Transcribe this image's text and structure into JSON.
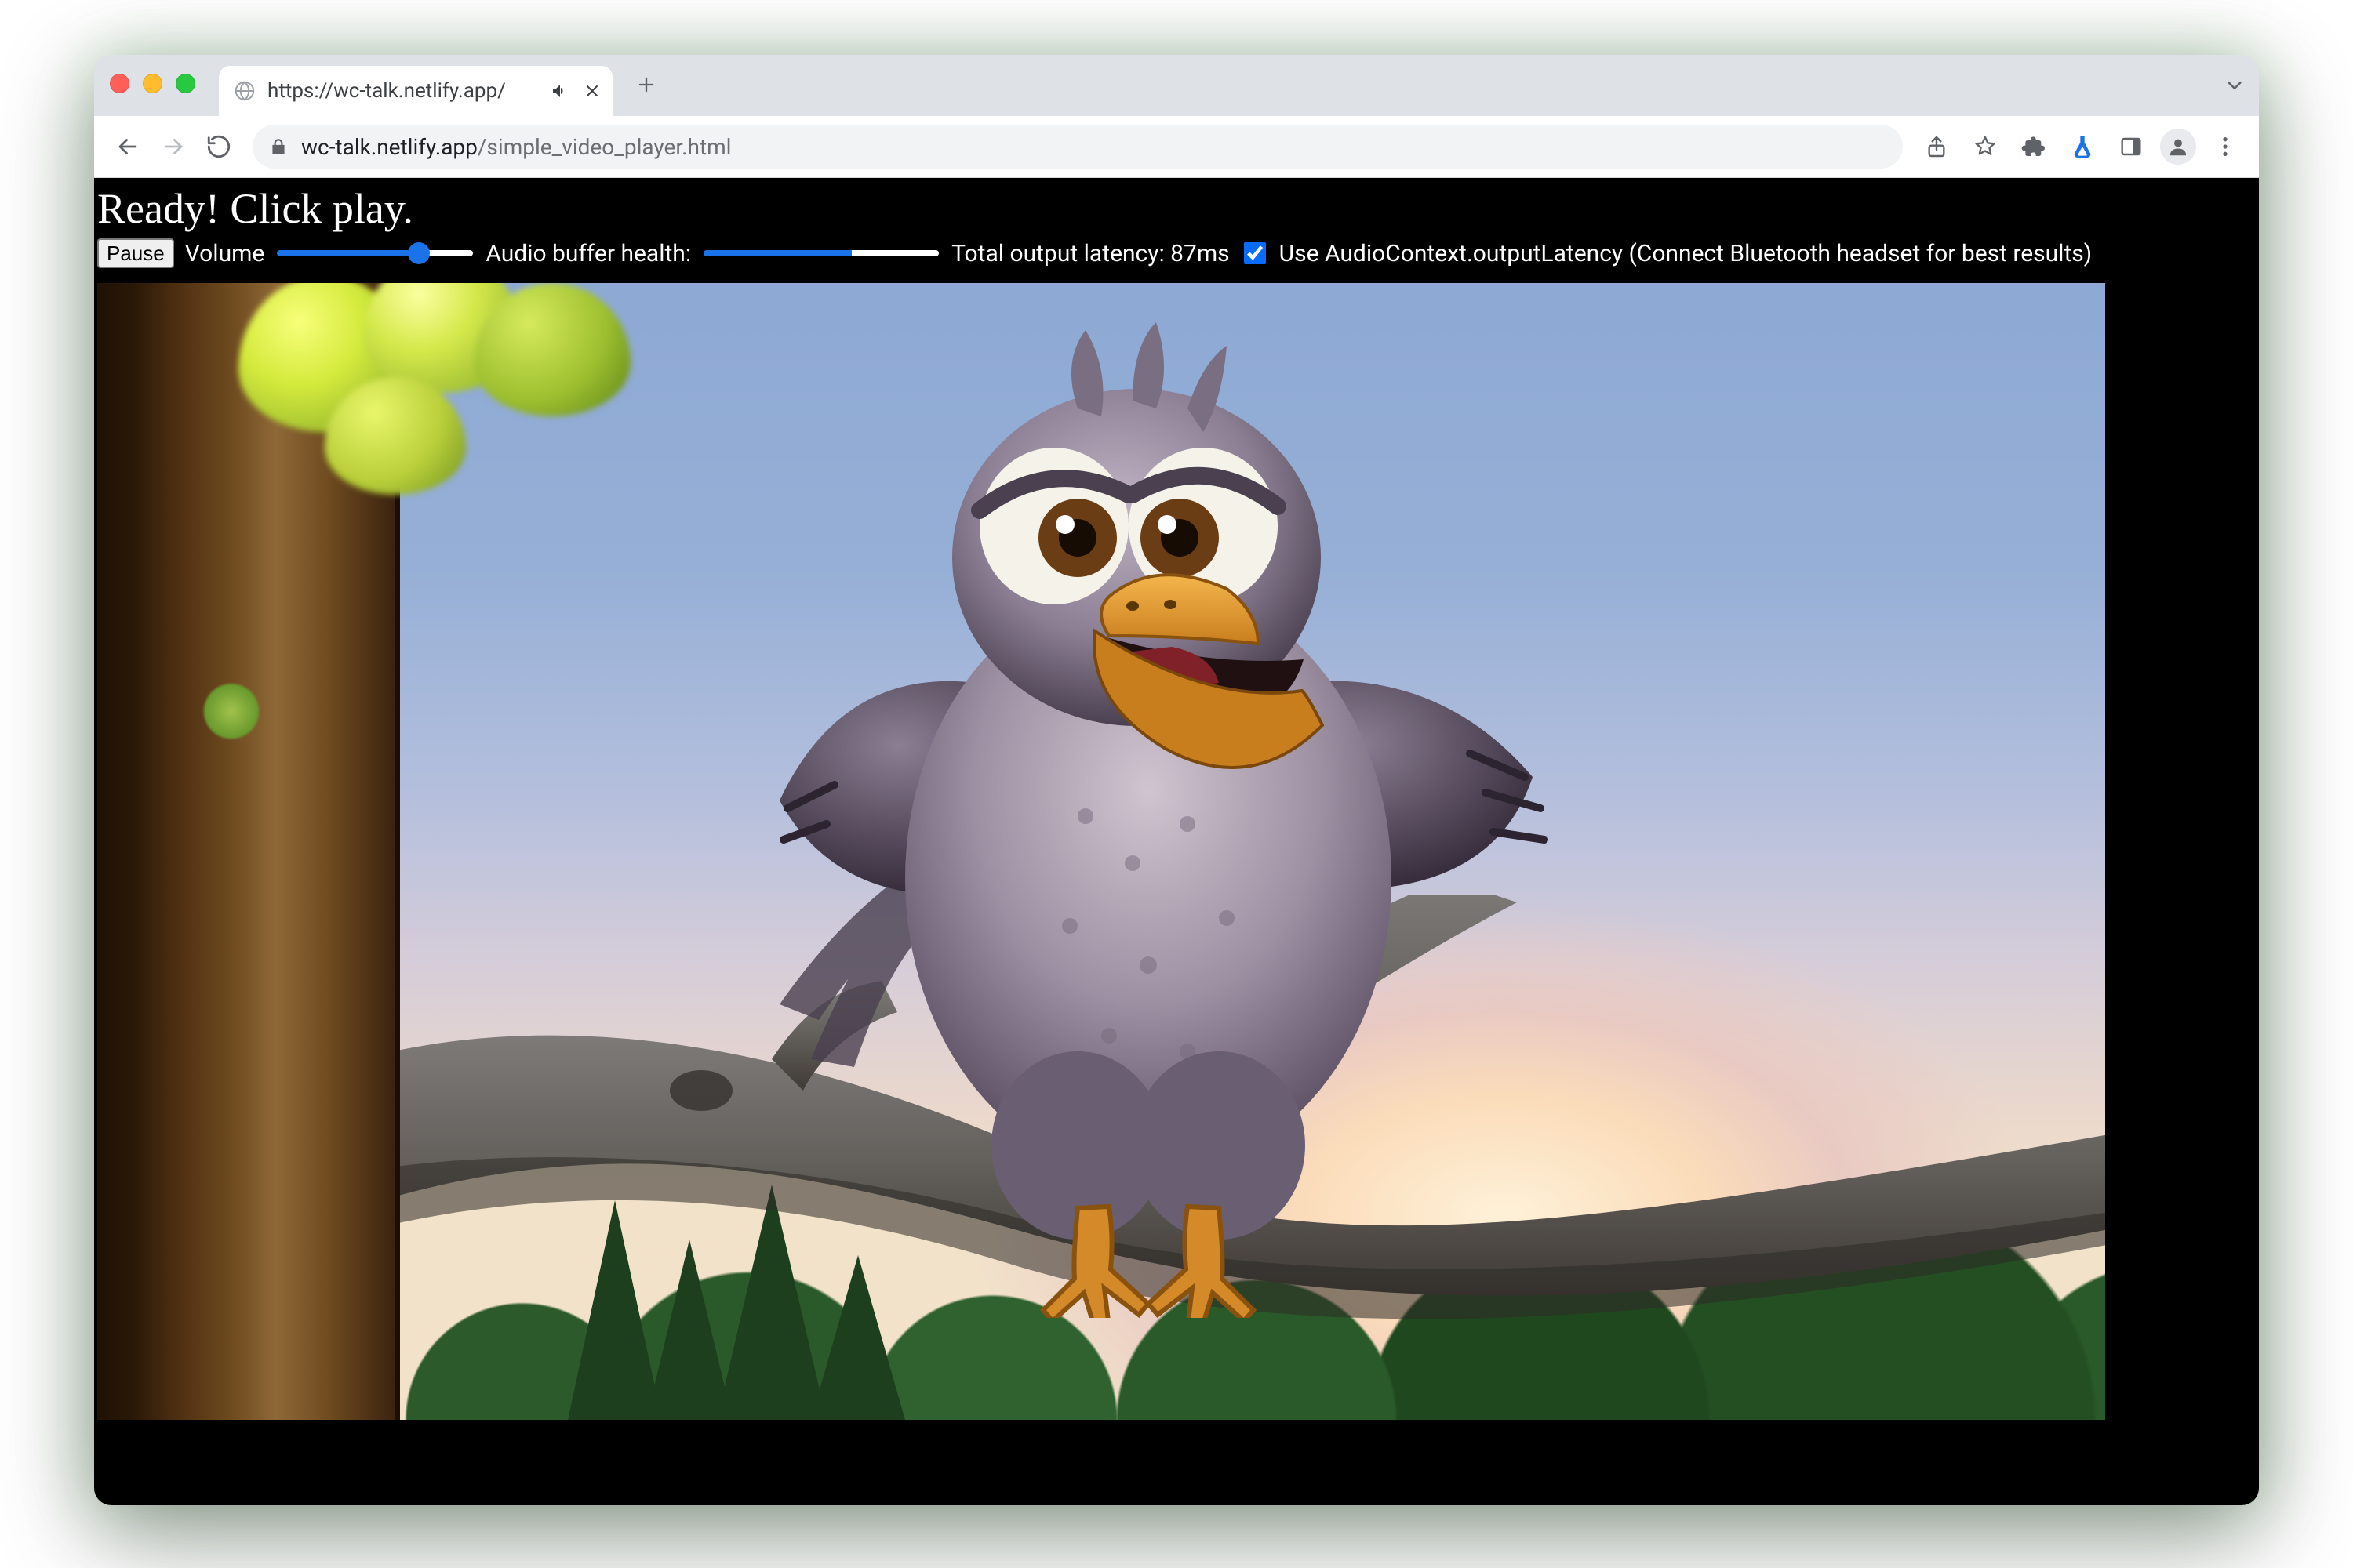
{
  "tab": {
    "title": "https://wc-talk.netlify.app/",
    "audio_playing": true
  },
  "address_bar": {
    "host": "wc-talk.netlify.app",
    "path": "/simple_video_player.html"
  },
  "page": {
    "status_heading": "Ready! Click play.",
    "pause_button": "Pause",
    "volume_label": "Volume",
    "volume_value": 75,
    "buffer_label": "Audio buffer health:",
    "buffer_value": 63,
    "latency_label_prefix": "Total output latency: ",
    "latency_value": "87ms",
    "use_output_latency_label": "Use AudioContext.outputLatency (Connect Bluetooth headset for best results)",
    "use_output_latency_checked": true
  }
}
